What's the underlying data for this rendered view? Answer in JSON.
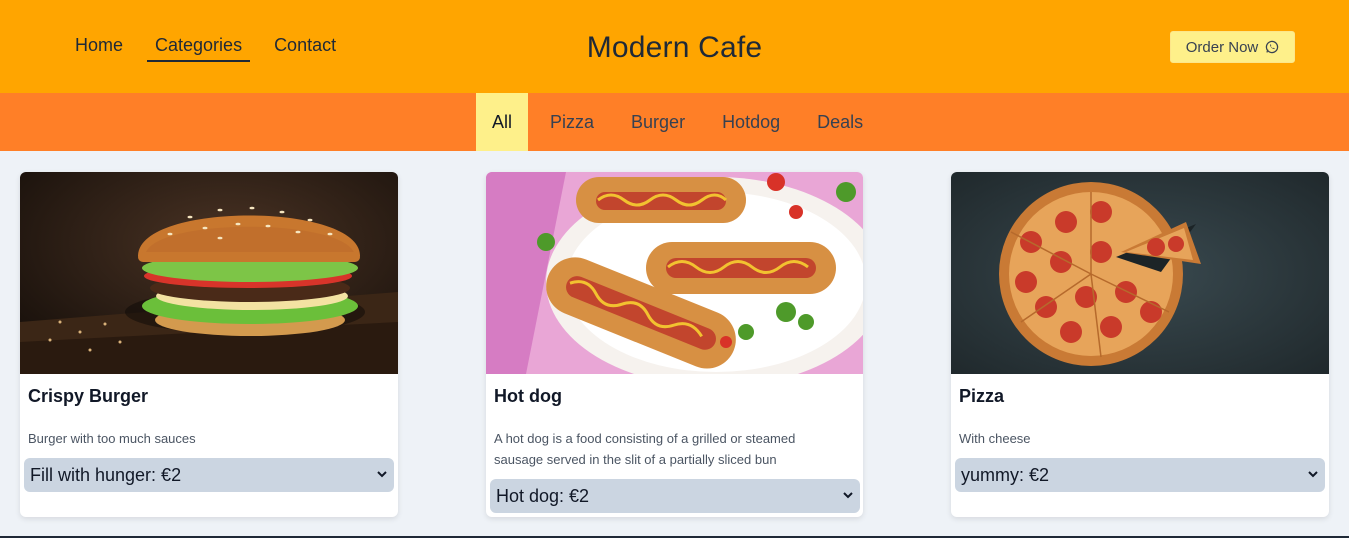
{
  "header": {
    "nav": [
      {
        "label": "Home"
      },
      {
        "label": "Categories",
        "active": true
      },
      {
        "label": "Contact"
      }
    ],
    "brand": "Modern Cafe",
    "order_button": {
      "label": "Order Now",
      "icon": "whatsapp-icon"
    }
  },
  "categories": [
    {
      "label": "All",
      "active": true
    },
    {
      "label": "Pizza"
    },
    {
      "label": "Burger"
    },
    {
      "label": "Hotdog"
    },
    {
      "label": "Deals"
    }
  ],
  "cards": [
    {
      "title": "Crispy Burger",
      "description": "Burger with too much sauces",
      "select_value": "Fill with hunger: €2",
      "image": "burger-photo"
    },
    {
      "title": "Hot dog",
      "description": "A hot dog is a food consisting of a grilled or steamed sausage served in the slit of a partially sliced bun",
      "select_value": "Hot dog: €2",
      "image": "hotdog-photo"
    },
    {
      "title": "Pizza",
      "description": "With cheese",
      "select_value": "yummy: €2",
      "image": "pizza-photo"
    }
  ],
  "colors": {
    "header_bg": "#ffa500",
    "catbar_bg": "#ff7f27",
    "active_bg": "#fef08a",
    "page_bg": "#eef2f7",
    "select_bg": "#cbd5e1"
  }
}
